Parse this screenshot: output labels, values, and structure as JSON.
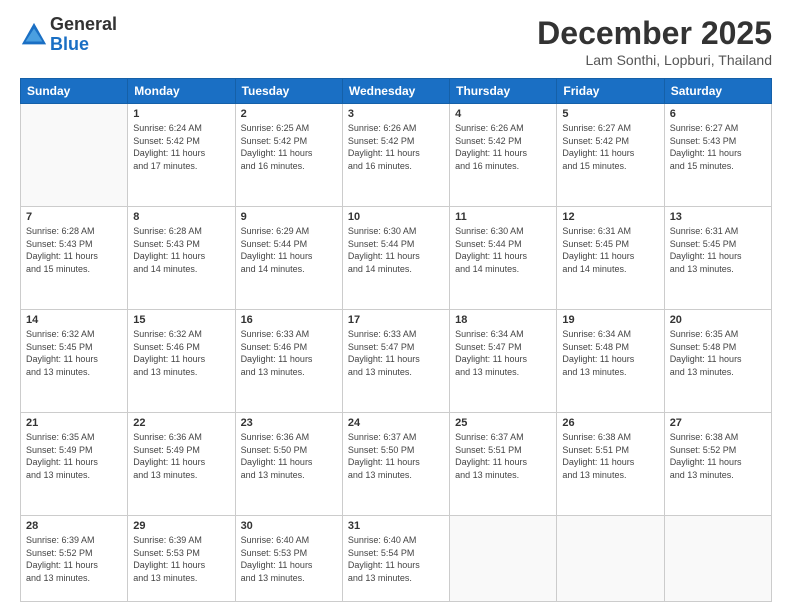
{
  "header": {
    "logo_general": "General",
    "logo_blue": "Blue",
    "month_title": "December 2025",
    "location": "Lam Sonthi, Lopburi, Thailand"
  },
  "days_of_week": [
    "Sunday",
    "Monday",
    "Tuesday",
    "Wednesday",
    "Thursday",
    "Friday",
    "Saturday"
  ],
  "weeks": [
    [
      {
        "day": "",
        "info": ""
      },
      {
        "day": "1",
        "info": "Sunrise: 6:24 AM\nSunset: 5:42 PM\nDaylight: 11 hours\nand 17 minutes."
      },
      {
        "day": "2",
        "info": "Sunrise: 6:25 AM\nSunset: 5:42 PM\nDaylight: 11 hours\nand 16 minutes."
      },
      {
        "day": "3",
        "info": "Sunrise: 6:26 AM\nSunset: 5:42 PM\nDaylight: 11 hours\nand 16 minutes."
      },
      {
        "day": "4",
        "info": "Sunrise: 6:26 AM\nSunset: 5:42 PM\nDaylight: 11 hours\nand 16 minutes."
      },
      {
        "day": "5",
        "info": "Sunrise: 6:27 AM\nSunset: 5:42 PM\nDaylight: 11 hours\nand 15 minutes."
      },
      {
        "day": "6",
        "info": "Sunrise: 6:27 AM\nSunset: 5:43 PM\nDaylight: 11 hours\nand 15 minutes."
      }
    ],
    [
      {
        "day": "7",
        "info": "Sunrise: 6:28 AM\nSunset: 5:43 PM\nDaylight: 11 hours\nand 15 minutes."
      },
      {
        "day": "8",
        "info": "Sunrise: 6:28 AM\nSunset: 5:43 PM\nDaylight: 11 hours\nand 14 minutes."
      },
      {
        "day": "9",
        "info": "Sunrise: 6:29 AM\nSunset: 5:44 PM\nDaylight: 11 hours\nand 14 minutes."
      },
      {
        "day": "10",
        "info": "Sunrise: 6:30 AM\nSunset: 5:44 PM\nDaylight: 11 hours\nand 14 minutes."
      },
      {
        "day": "11",
        "info": "Sunrise: 6:30 AM\nSunset: 5:44 PM\nDaylight: 11 hours\nand 14 minutes."
      },
      {
        "day": "12",
        "info": "Sunrise: 6:31 AM\nSunset: 5:45 PM\nDaylight: 11 hours\nand 14 minutes."
      },
      {
        "day": "13",
        "info": "Sunrise: 6:31 AM\nSunset: 5:45 PM\nDaylight: 11 hours\nand 13 minutes."
      }
    ],
    [
      {
        "day": "14",
        "info": "Sunrise: 6:32 AM\nSunset: 5:45 PM\nDaylight: 11 hours\nand 13 minutes."
      },
      {
        "day": "15",
        "info": "Sunrise: 6:32 AM\nSunset: 5:46 PM\nDaylight: 11 hours\nand 13 minutes."
      },
      {
        "day": "16",
        "info": "Sunrise: 6:33 AM\nSunset: 5:46 PM\nDaylight: 11 hours\nand 13 minutes."
      },
      {
        "day": "17",
        "info": "Sunrise: 6:33 AM\nSunset: 5:47 PM\nDaylight: 11 hours\nand 13 minutes."
      },
      {
        "day": "18",
        "info": "Sunrise: 6:34 AM\nSunset: 5:47 PM\nDaylight: 11 hours\nand 13 minutes."
      },
      {
        "day": "19",
        "info": "Sunrise: 6:34 AM\nSunset: 5:48 PM\nDaylight: 11 hours\nand 13 minutes."
      },
      {
        "day": "20",
        "info": "Sunrise: 6:35 AM\nSunset: 5:48 PM\nDaylight: 11 hours\nand 13 minutes."
      }
    ],
    [
      {
        "day": "21",
        "info": "Sunrise: 6:35 AM\nSunset: 5:49 PM\nDaylight: 11 hours\nand 13 minutes."
      },
      {
        "day": "22",
        "info": "Sunrise: 6:36 AM\nSunset: 5:49 PM\nDaylight: 11 hours\nand 13 minutes."
      },
      {
        "day": "23",
        "info": "Sunrise: 6:36 AM\nSunset: 5:50 PM\nDaylight: 11 hours\nand 13 minutes."
      },
      {
        "day": "24",
        "info": "Sunrise: 6:37 AM\nSunset: 5:50 PM\nDaylight: 11 hours\nand 13 minutes."
      },
      {
        "day": "25",
        "info": "Sunrise: 6:37 AM\nSunset: 5:51 PM\nDaylight: 11 hours\nand 13 minutes."
      },
      {
        "day": "26",
        "info": "Sunrise: 6:38 AM\nSunset: 5:51 PM\nDaylight: 11 hours\nand 13 minutes."
      },
      {
        "day": "27",
        "info": "Sunrise: 6:38 AM\nSunset: 5:52 PM\nDaylight: 11 hours\nand 13 minutes."
      }
    ],
    [
      {
        "day": "28",
        "info": "Sunrise: 6:39 AM\nSunset: 5:52 PM\nDaylight: 11 hours\nand 13 minutes."
      },
      {
        "day": "29",
        "info": "Sunrise: 6:39 AM\nSunset: 5:53 PM\nDaylight: 11 hours\nand 13 minutes."
      },
      {
        "day": "30",
        "info": "Sunrise: 6:40 AM\nSunset: 5:53 PM\nDaylight: 11 hours\nand 13 minutes."
      },
      {
        "day": "31",
        "info": "Sunrise: 6:40 AM\nSunset: 5:54 PM\nDaylight: 11 hours\nand 13 minutes."
      },
      {
        "day": "",
        "info": ""
      },
      {
        "day": "",
        "info": ""
      },
      {
        "day": "",
        "info": ""
      }
    ]
  ]
}
